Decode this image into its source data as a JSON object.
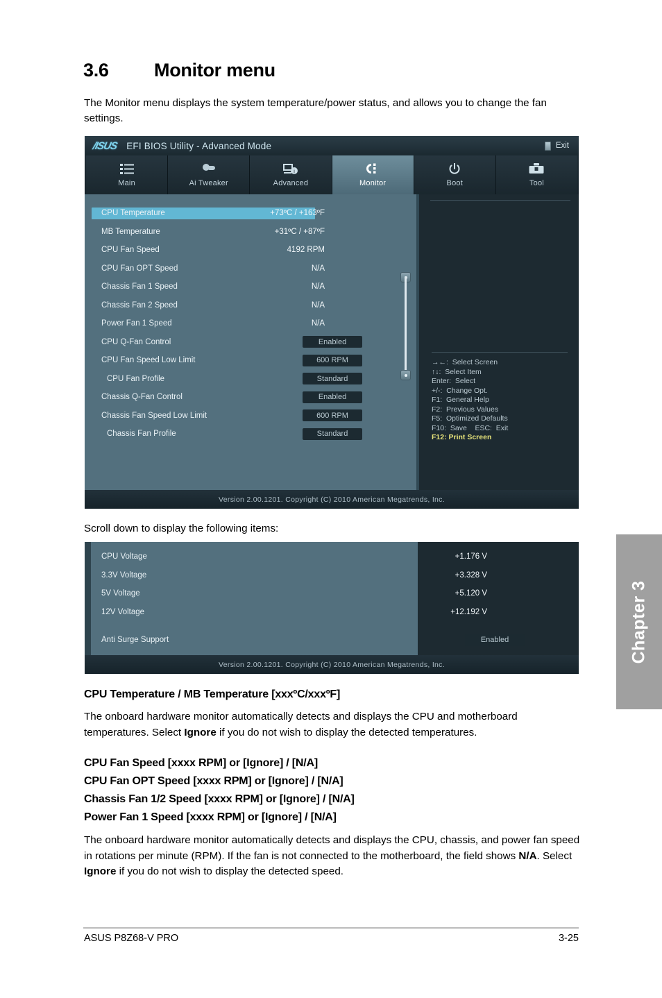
{
  "section": {
    "number": "3.6",
    "title": "Monitor menu",
    "intro": "The Monitor menu displays the system temperature/power status, and allows you to change the fan settings.",
    "caption": "Scroll down to display the following items:"
  },
  "bios": {
    "logo": "/ISUS",
    "title": "EFI BIOS Utility - Advanced Mode",
    "exit_label": "Exit",
    "tabs": [
      {
        "label": "Main",
        "icon": "list-icon",
        "active": false
      },
      {
        "label": "Ai  Tweaker",
        "icon": "tuning-icon",
        "active": false
      },
      {
        "label": "Advanced",
        "icon": "advanced-icon",
        "active": false
      },
      {
        "label": "Monitor",
        "icon": "monitor-icon",
        "active": true
      },
      {
        "label": "Boot",
        "icon": "power-icon",
        "active": false
      },
      {
        "label": "Tool",
        "icon": "toolbox-icon",
        "active": false
      }
    ],
    "version": "Version  2.00.1201.   Copyright  (C)  2010  American  Megatrends,  Inc.",
    "screen1_rows": [
      {
        "label": "CPU Temperature",
        "value": "+73ºC / +163ºF",
        "type": "value",
        "selected": true,
        "indent": false
      },
      {
        "label": "MB Temperature",
        "value": "+31ºC / +87ºF",
        "type": "value",
        "selected": false,
        "indent": false
      },
      {
        "label": "CPU Fan Speed",
        "value": "4192 RPM",
        "type": "value",
        "selected": false,
        "indent": false
      },
      {
        "label": "CPU Fan OPT Speed",
        "value": "N/A",
        "type": "value",
        "selected": false,
        "indent": false
      },
      {
        "label": "Chassis Fan 1 Speed",
        "value": "N/A",
        "type": "value",
        "selected": false,
        "indent": false
      },
      {
        "label": "Chassis Fan 2 Speed",
        "value": "N/A",
        "type": "value",
        "selected": false,
        "indent": false
      },
      {
        "label": "Power Fan 1 Speed",
        "value": "N/A",
        "type": "value",
        "selected": false,
        "indent": false
      },
      {
        "label": "CPU Q-Fan Control",
        "value": "Enabled",
        "type": "option",
        "selected": false,
        "indent": false
      },
      {
        "label": "CPU Fan Speed Low Limit",
        "value": "600 RPM",
        "type": "option",
        "selected": false,
        "indent": false
      },
      {
        "label": "CPU Fan Profile",
        "value": "Standard",
        "type": "option",
        "selected": false,
        "indent": true
      },
      {
        "label": "Chassis Q-Fan Control",
        "value": "Enabled",
        "type": "option",
        "selected": false,
        "indent": false
      },
      {
        "label": "Chassis Fan Speed Low Limit",
        "value": "600 RPM",
        "type": "option",
        "selected": false,
        "indent": false
      },
      {
        "label": "Chassis Fan Profile",
        "value": "Standard",
        "type": "option",
        "selected": false,
        "indent": true
      }
    ],
    "help_lines": [
      {
        "text": "→←:  Select Screen",
        "hot": false
      },
      {
        "text": "↑↓:  Select Item",
        "hot": false
      },
      {
        "text": "Enter:  Select",
        "hot": false
      },
      {
        "text": "+/-:  Change Opt.",
        "hot": false
      },
      {
        "text": "F1:  General Help",
        "hot": false
      },
      {
        "text": "F2:  Previous Values",
        "hot": false
      },
      {
        "text": "F5:  Optimized Defaults",
        "hot": false
      },
      {
        "text": "F10:  Save    ESC:  Exit",
        "hot": false
      },
      {
        "text": "F12: Print Screen",
        "hot": true
      }
    ],
    "screen2_rows": [
      {
        "label": "CPU Voltage",
        "value": "+1.176 V",
        "type": "value",
        "indent": false
      },
      {
        "label": "3.3V Voltage",
        "value": "+3.328 V",
        "type": "value",
        "indent": false
      },
      {
        "label": "5V Voltage",
        "value": "+5.120 V",
        "type": "value",
        "indent": false
      },
      {
        "label": "12V Voltage",
        "value": "+12.192 V",
        "type": "value",
        "indent": false
      },
      {
        "label": "",
        "value": "",
        "type": "spacer",
        "indent": false
      },
      {
        "label": "Anti Surge Support",
        "value": "Enabled",
        "type": "option",
        "indent": false
      }
    ]
  },
  "chapter_tab": "Chapter 3",
  "content": {
    "heading_temp": "CPU Temperature / MB Temperature [xxxºC/xxxºF]",
    "para_temp_a": "The onboard hardware monitor automatically detects and displays the CPU and motherboard temperatures. Select ",
    "para_temp_b": "Ignore",
    "para_temp_c": " if you do not wish to display the detected temperatures.",
    "heading_fan_1": "CPU Fan Speed [xxxx RPM] or [Ignore] / [N/A]",
    "heading_fan_2": "CPU Fan OPT Speed [xxxx RPM] or [Ignore] / [N/A]",
    "heading_fan_3": "Chassis Fan 1/2 Speed [xxxx RPM] or [Ignore] / [N/A]",
    "heading_fan_4": "Power Fan 1 Speed [xxxx RPM] or [Ignore] / [N/A]",
    "para_fan_a": "The onboard hardware monitor automatically detects and displays the CPU, chassis, and power fan speed in rotations per minute (RPM). If the fan is not connected to the motherboard, the field shows ",
    "para_fan_b": "N/A",
    "para_fan_c": ". Select ",
    "para_fan_d": "Ignore",
    "para_fan_e": " if you do not wish to display the detected speed."
  },
  "footer": {
    "left": "ASUS P8Z68-V PRO",
    "right": "3-25"
  },
  "colors": {
    "panel": "#53707e",
    "highlight": "#62b7d4",
    "dark_panel": "#1d2a31",
    "hotkey": "#e5e27a",
    "chapter_tab": "#a0a0a0"
  }
}
